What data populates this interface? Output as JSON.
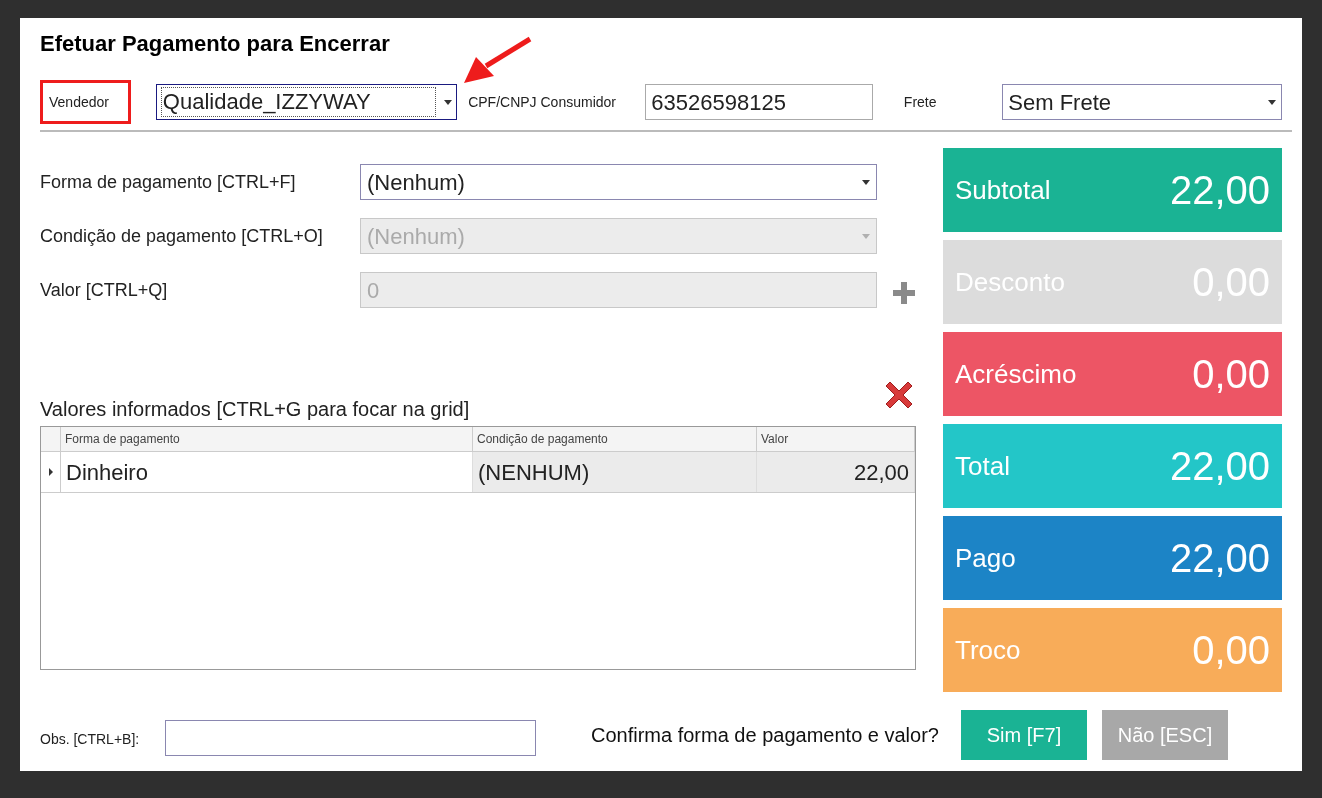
{
  "dialog": {
    "title": "Efetuar Pagamento para Encerrar"
  },
  "header": {
    "seller": {
      "label": "Vendedor",
      "value": "Qualidade_IZZYWAY",
      "highlighted": true
    },
    "customer_id": {
      "label": "CPF/CNPJ Consumidor",
      "value": "63526598125"
    },
    "freight": {
      "label": "Frete",
      "value": "Sem Frete"
    }
  },
  "fields": [
    {
      "kind": "select",
      "label": "Forma de pagamento [CTRL+F]",
      "value": "(Nenhum)",
      "disabled": false
    },
    {
      "kind": "select",
      "label": "Condição de pagamento [CTRL+O]",
      "value": "(Nenhum)",
      "disabled": true
    },
    {
      "kind": "input",
      "label": "Valor [CTRL+Q]",
      "value": "0",
      "disabled": true
    }
  ],
  "grid": {
    "title": "Valores informados [CTRL+G para focar na grid]",
    "columns": [
      "Forma de pagamento",
      "Condição de pagamento",
      "Valor"
    ],
    "rows": [
      {
        "cells": [
          "Dinheiro",
          "(NENHUM)",
          "22,00"
        ],
        "selected": true
      }
    ]
  },
  "totals": [
    {
      "label": "Subtotal",
      "value": "22,00",
      "color": "#1ab394"
    },
    {
      "label": "Desconto",
      "value": "0,00",
      "color": "#dcdcdc"
    },
    {
      "label": "Acréscimo",
      "value": "0,00",
      "color": "#ed5565"
    },
    {
      "label": "Total",
      "value": "22,00",
      "color": "#23c6c8"
    },
    {
      "label": "Pago",
      "value": "22,00",
      "color": "#1c84c6"
    },
    {
      "label": "Troco",
      "value": "0,00",
      "color": "#f8ac59"
    }
  ],
  "footer": {
    "notes_label": "Obs. [CTRL+B]:",
    "question": "Confirma forma de pagamento e valor?",
    "buttons": [
      {
        "label": "Sim [F7]",
        "disabled": false
      },
      {
        "label": "Não [ESC]",
        "disabled": true
      }
    ]
  }
}
